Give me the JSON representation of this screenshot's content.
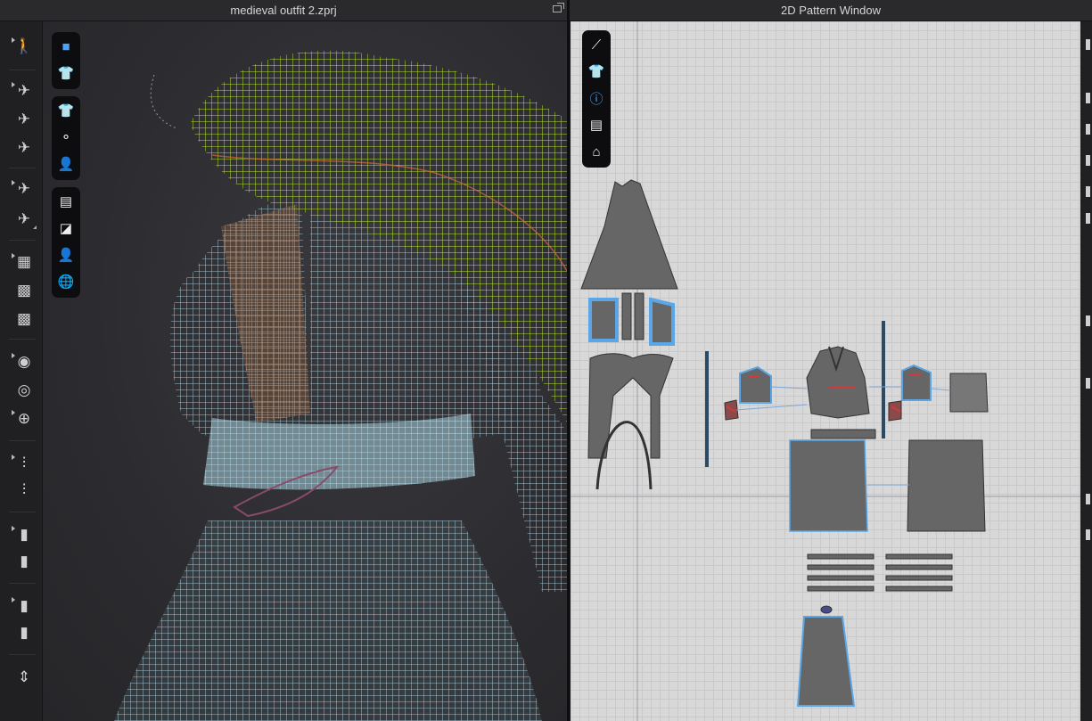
{
  "window_3d": {
    "title": "medieval outfit 2.zprj",
    "icon": "restore-window-icon"
  },
  "window_2d": {
    "title": "2D Pattern Window"
  },
  "accent_colors": {
    "selection": "#5aa6e6",
    "wire_green": "#a6d61e",
    "wire_blue": "#9fd0e6",
    "pattern": "#666666",
    "seam_red": "#d23a3a"
  },
  "left_toolbar": {
    "tools": [
      "pose-icon",
      "simulate-icon",
      "tack-icon",
      "fold-icon",
      "arrange-icon",
      "attach-icon",
      "fold-arrangement-icon",
      "fitting-icon",
      "avatar-icon",
      "pin-icon",
      "button-icon",
      "buttonhole-icon",
      "zipper-icon",
      "puckering-icon",
      "bind-icon",
      "topstitch-icon",
      "gizmo-icon",
      "measure-icon",
      "transform-icon"
    ]
  },
  "palette_3d": {
    "groups": [
      [
        "cube-icon",
        "garment-icon"
      ],
      [
        "tshirt-icon",
        "pins-icon",
        "avatar-icon"
      ],
      [
        "texture-icon",
        "fabric-icon",
        "skin-icon",
        "globe-icon"
      ]
    ]
  },
  "palette_2d": {
    "tools": [
      "needle-icon",
      "tshirt-icon",
      "info-icon",
      "texture-icon",
      "garment-home-icon"
    ]
  }
}
